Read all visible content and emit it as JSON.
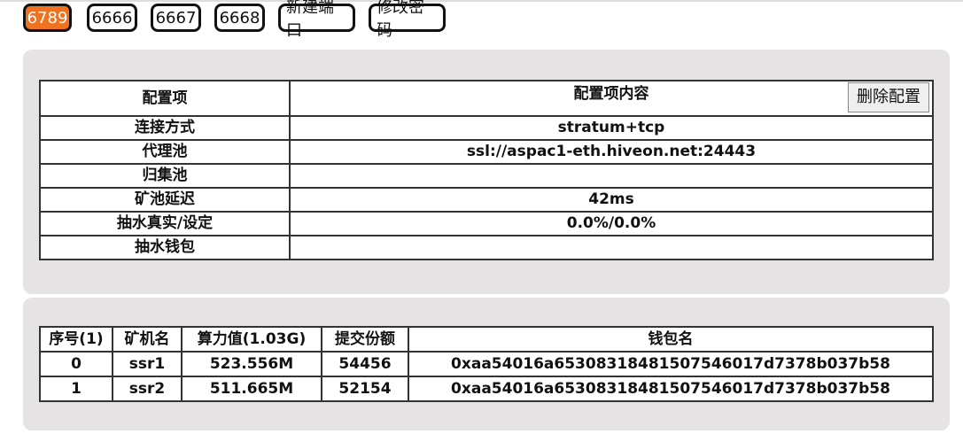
{
  "tabs": [
    {
      "label": "6789",
      "active": true
    },
    {
      "label": "6666",
      "active": false
    },
    {
      "label": "6667",
      "active": false
    },
    {
      "label": "6668",
      "active": false
    },
    {
      "label": "新建端口",
      "active": false
    },
    {
      "label": "修改密码",
      "active": false
    }
  ],
  "config": {
    "header_key": "配置项",
    "header_value": "配置项内容",
    "delete_button": "删除配置",
    "rows": [
      {
        "key": "连接方式",
        "value": "stratum+tcp"
      },
      {
        "key": "代理池",
        "value": "ssl://aspac1-eth.hiveon.net:24443"
      },
      {
        "key": "归集池",
        "value": ""
      },
      {
        "key": "矿池延迟",
        "value": "42ms"
      },
      {
        "key": "抽水真实/设定",
        "value": "0.0%/0.0%"
      },
      {
        "key": "抽水钱包",
        "value": ""
      }
    ]
  },
  "miners": {
    "headers": [
      "序号(1)",
      "矿机名",
      "算力值(1.03G)",
      "提交份额",
      "钱包名"
    ],
    "rows": [
      [
        "0",
        "ssr1",
        "523.556M",
        "54456",
        "0xaa54016a6530831848150754 6017d7378b037b58"
      ],
      [
        "1",
        "ssr2",
        "511.665M",
        "52154",
        "0xaa54016a653083184815075 46017d7378b037b58"
      ]
    ]
  },
  "colors": {
    "active_tab": "#ee7220",
    "panel_bg": "#e5e3e4"
  }
}
